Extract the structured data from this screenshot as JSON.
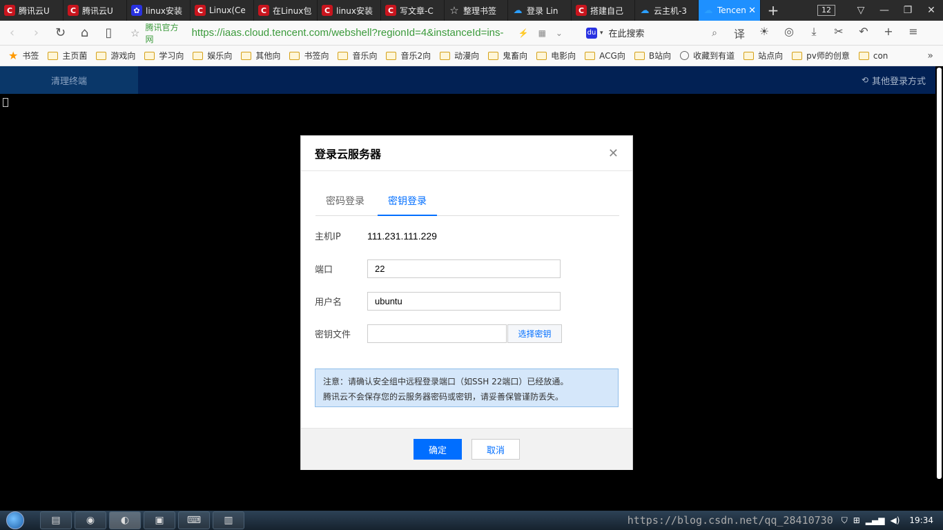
{
  "browser": {
    "tabs": [
      {
        "icon": "c",
        "title": "腾讯云U"
      },
      {
        "icon": "c",
        "title": "腾讯云U"
      },
      {
        "icon": "baidu",
        "title": "linux安装"
      },
      {
        "icon": "c",
        "title": "Linux(Ce"
      },
      {
        "icon": "c",
        "title": "在Linux包"
      },
      {
        "icon": "c",
        "title": "linux安装"
      },
      {
        "icon": "c",
        "title": "写文章-C"
      },
      {
        "icon": "star",
        "title": "整理书签"
      },
      {
        "icon": "cloud",
        "title": "登录 Lin"
      },
      {
        "icon": "c",
        "title": "搭建自己"
      },
      {
        "icon": "cloud",
        "title": "云主机-3"
      }
    ],
    "active_tab": {
      "title": "Tencen"
    },
    "tab_count": "12",
    "site_label": "腾讯官方网",
    "url": "https://iaas.cloud.tencent.com/webshell?regionId=4&instanceId=ins-",
    "search_placeholder": "在此搜索",
    "bookmarks": [
      {
        "type": "star",
        "label": "书签"
      },
      {
        "type": "folder",
        "label": "主页菌"
      },
      {
        "type": "folder",
        "label": "游戏向"
      },
      {
        "type": "folder",
        "label": "学习向"
      },
      {
        "type": "folder",
        "label": "娱乐向"
      },
      {
        "type": "folder",
        "label": "其他向"
      },
      {
        "type": "folder",
        "label": "书签向"
      },
      {
        "type": "folder",
        "label": "音乐向"
      },
      {
        "type": "folder",
        "label": "音乐2向"
      },
      {
        "type": "folder",
        "label": "动漫向"
      },
      {
        "type": "folder",
        "label": "鬼畜向"
      },
      {
        "type": "folder",
        "label": "电影向"
      },
      {
        "type": "folder",
        "label": "ACG向"
      },
      {
        "type": "folder",
        "label": "B站向"
      },
      {
        "type": "globe",
        "label": "收藏到有道"
      },
      {
        "type": "folder",
        "label": "站点向"
      },
      {
        "type": "folder",
        "label": "pv师的创意"
      },
      {
        "type": "folder",
        "label": "con"
      }
    ]
  },
  "page": {
    "clear_terminal": "清理终端",
    "other_login": "其他登录方式"
  },
  "modal": {
    "title": "登录云服务器",
    "tabs": [
      "密码登录",
      "密钥登录"
    ],
    "active_tab_index": 1,
    "host_label": "主机IP",
    "host_value": "111.231.111.229",
    "port_label": "端口",
    "port_value": "22",
    "user_label": "用户名",
    "user_value": "ubuntu",
    "key_label": "密钥文件",
    "key_value": "",
    "choose_key": "选择密钥",
    "notice_line1": "注意：请确认安全组中远程登录端口（如SSH 22端口）已经放通。",
    "notice_line2": "腾讯云不会保存您的云服务器密码或密钥，请妥善保管谨防丢失。",
    "confirm": "确定",
    "cancel": "取消"
  },
  "taskbar": {
    "watermark": "https://blog.csdn.net/qq_28410730",
    "time": "19:34"
  },
  "colors": {
    "primary": "#006eff",
    "header_bg": "#022154",
    "active_tab": "#1e90ff"
  }
}
